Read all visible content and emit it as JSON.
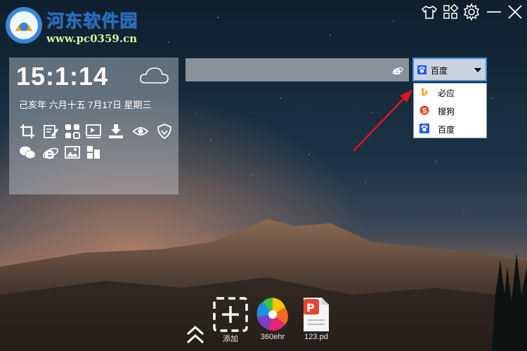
{
  "watermark": {
    "site_name": "河东软件园",
    "site_url": "www.pc0359.cn"
  },
  "window_controls": {
    "icons": [
      "shirt-icon",
      "grid-icon",
      "gear-icon",
      "minimize-icon",
      "close-icon"
    ]
  },
  "widget": {
    "time": "15:1:14",
    "date": "己亥年 六月十五 7月17日 星期三",
    "weather_icon": "cloud-icon",
    "tools_row1": [
      "crop-icon",
      "edit-note-icon",
      "qr-code-icon",
      "presentation-icon",
      "download-icon",
      "eye-icon",
      "shield-icon"
    ],
    "tools_row2": [
      "wechat-icon",
      "ie-browser-icon",
      "image-icon",
      "cube-icon"
    ]
  },
  "search": {
    "input_value": "",
    "browser_icon": "ie-browser-icon",
    "selected_engine": "百度",
    "engines": [
      {
        "label": "必应",
        "icon": "bing-icon",
        "color": "#f5a623"
      },
      {
        "label": "搜狗",
        "icon": "sogou-icon",
        "color": "#e8442c"
      },
      {
        "label": "百度",
        "icon": "baidu-icon",
        "color": "#2b5ee0"
      }
    ]
  },
  "dock": {
    "items": [
      {
        "label": "添加",
        "icon": "add-icon"
      },
      {
        "label": "360ehr",
        "icon": "pinwheel-icon"
      },
      {
        "label": "123.pd",
        "icon": "pdf-file-icon"
      }
    ],
    "expand_icon": "double-chevron-up-icon"
  },
  "colors": {
    "accent": "#3b8fe6",
    "arrow": "#e0141c",
    "watermark_blue": "#1e6fd0"
  }
}
